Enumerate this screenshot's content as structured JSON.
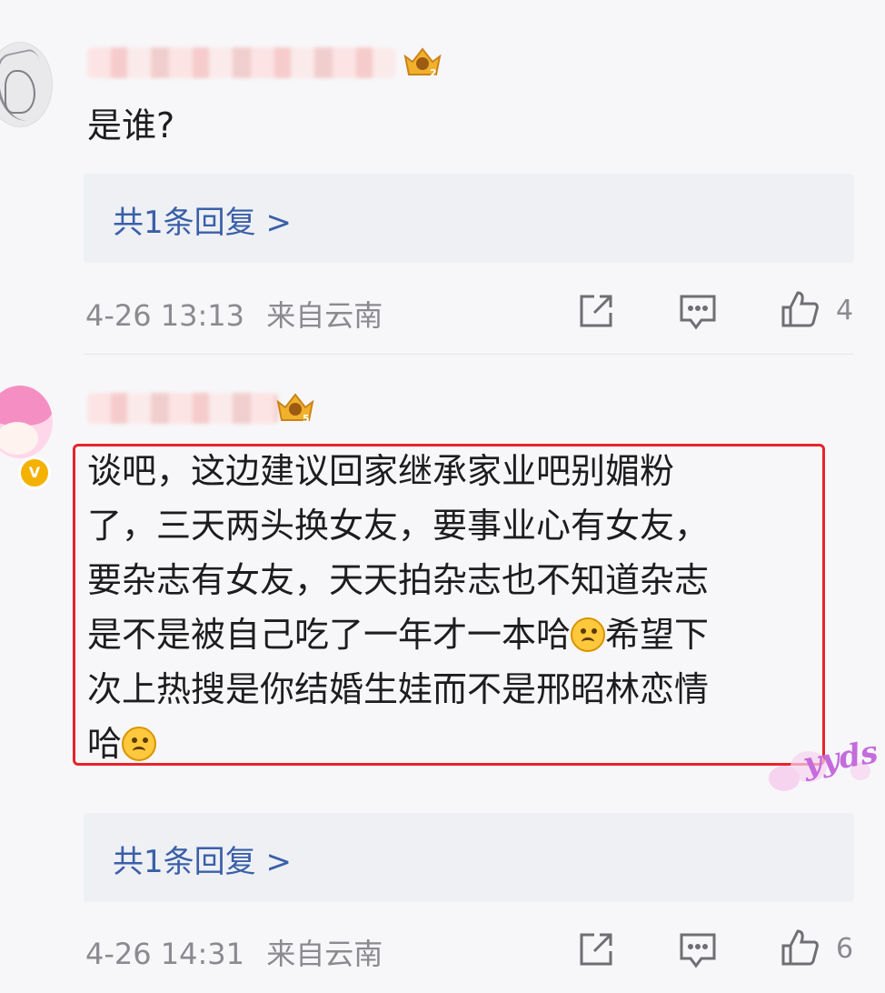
{
  "comments": [
    {
      "text": "是谁?",
      "replies_label": "共1条回复 >",
      "timestamp": "4-26 13:13",
      "location": "来自云南",
      "like_count": "4",
      "level_badge": "2"
    },
    {
      "text_lines": [
        "谈吧，这边建议回家继承家业吧别媚粉",
        "了，三天两头换女友，要事业心有女友，",
        "要杂志有女友，天天拍杂志也不知道杂志",
        "是不是被自己吃了一年才一本哈",
        "希望下",
        "次上热搜是你结婚生娃而不是邢昭林恋情",
        "哈"
      ],
      "replies_label": "共1条回复 >",
      "timestamp": "4-26 14:31",
      "location": "来自云南",
      "like_count": "6",
      "level_badge": "5",
      "verified_badge": "V",
      "sticker_text": "yyds"
    }
  ],
  "colors": {
    "highlight": "#e6252b",
    "link": "#3a5fa8",
    "meta": "#8a8a90",
    "reply_bg": "#eef0f4"
  },
  "icons": [
    "share-icon",
    "comment-icon",
    "like-icon",
    "crown-badge-icon",
    "upside-down-face-emoji"
  ]
}
